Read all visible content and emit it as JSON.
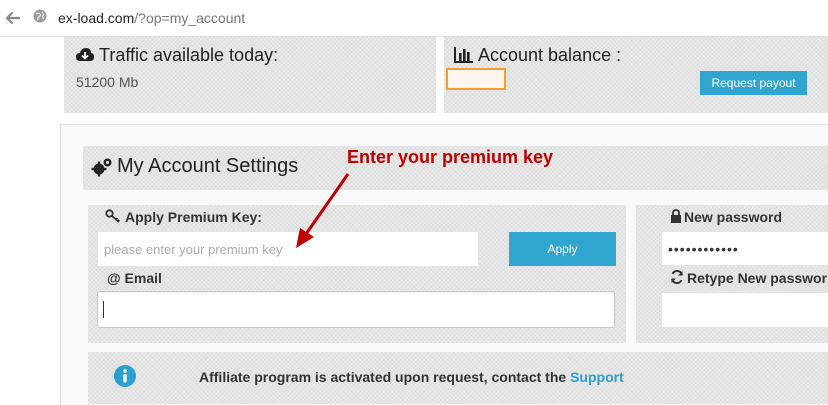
{
  "browser": {
    "url_host": "ex-load.com",
    "url_path": "/?op=my_account"
  },
  "traffic": {
    "title": "Traffic available today:",
    "value": "51200 Mb"
  },
  "balance": {
    "title": "Account balance :",
    "value": "",
    "request_payout_label": "Request payout"
  },
  "settings": {
    "title": "My Account Settings",
    "annotation": "Enter your premium key",
    "premium_key": {
      "label": "Apply Premium Key:",
      "placeholder": "please enter your premium key",
      "value": "",
      "apply_label": "Apply"
    },
    "email": {
      "label": "@ Email",
      "value": ""
    },
    "new_password": {
      "label": "New password",
      "value": "••••••••••••"
    },
    "retype_password": {
      "label": "Retype New passwor",
      "value": ""
    }
  },
  "affiliate": {
    "text": "Affiliate program is activated upon request, contact the",
    "link": "Support"
  },
  "colors": {
    "accent": "#30a5cf",
    "annotation": "#c00000",
    "balance_highlight": "#f0a030"
  }
}
